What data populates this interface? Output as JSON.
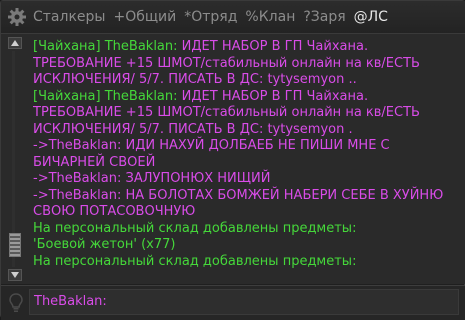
{
  "tabs": [
    {
      "label": "Сталкеры",
      "active": false
    },
    {
      "label": "+Общий",
      "active": false
    },
    {
      "label": "*Отряд",
      "active": false
    },
    {
      "label": "%Клан",
      "active": false
    },
    {
      "label": "?Заря",
      "active": false
    },
    {
      "label": "@ЛС",
      "active": true
    }
  ],
  "messages": [
    {
      "prefix": "[Чайхана] TheBaklan: ",
      "prefix_color": "green",
      "text": "ИДЕТ НАБОР В ГП Чайхана. ТРЕБОВАНИЕ +15 ШМОТ/стабильный онлайн на кв/ЕСТЬ ИСКЛЮЧЕНИЯ/ 5/7. ПИСАТЬ В ДС: tytysemyon ..",
      "color": "magenta"
    },
    {
      "prefix": "[Чайхана] TheBaklan: ",
      "prefix_color": "green",
      "text": "ИДЕТ НАБОР В ГП Чайхана. ТРЕБОВАНИЕ +15 ШМОТ/стабильный онлайн на кв/ЕСТЬ ИСКЛЮЧЕНИЯ/ 5/7. ПИСАТЬ В ДС: tytysemyon .",
      "color": "magenta"
    },
    {
      "prefix": "",
      "prefix_color": "magenta",
      "text": "->TheBaklan: ИДИ НАХУЙ ДОЛБАЕБ НЕ ПИШИ МНЕ С БИЧАРНЕЙ СВОЕЙ",
      "color": "magenta"
    },
    {
      "prefix": "",
      "prefix_color": "magenta",
      "text": "->TheBaklan: ЗАЛУПОНЮХ НИЩИЙ",
      "color": "magenta"
    },
    {
      "prefix": "",
      "prefix_color": "magenta",
      "text": "->TheBaklan: НА БОЛОТАХ БОМЖЕЙ НАБЕРИ СЕБЕ В ХУЙНЮ СВОЮ ПОТАСОВОЧНУЮ",
      "color": "magenta"
    },
    {
      "prefix": "",
      "prefix_color": "green",
      "text": "На персональный склад добавлены предметы:",
      "color": "green"
    },
    {
      "prefix": "",
      "prefix_color": "green",
      "text": "'Боевой жетон' (x77)",
      "color": "green"
    },
    {
      "prefix": "",
      "prefix_color": "green",
      "text": "На персональный склад добавлены предметы:",
      "color": "green"
    }
  ],
  "input": {
    "value": "TheBaklan:"
  },
  "icons": {
    "settings": "gear-icon",
    "hint": "lightbulb-icon"
  },
  "colors": {
    "green": "#45d83a",
    "magenta": "#d94ce8",
    "tab_active": "#e6e6e6",
    "tab_inactive": "#8c8c8c"
  }
}
